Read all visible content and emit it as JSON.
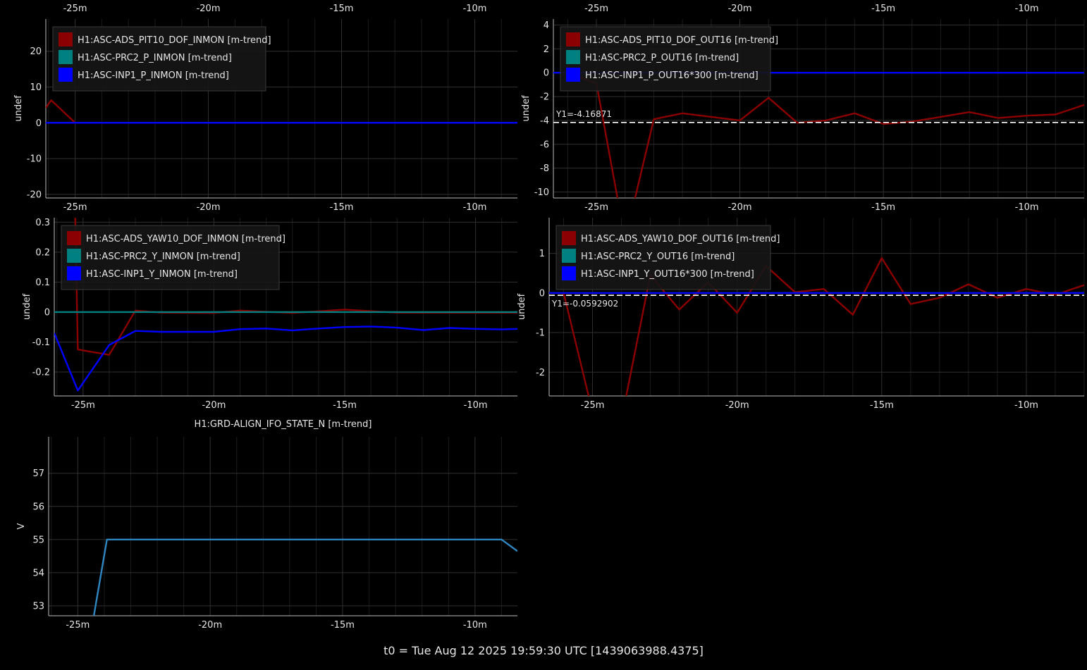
{
  "footer": "t0 = Tue Aug 12 2025 19:59:30 UTC [1439063988.4375]",
  "colors": {
    "background": "#000000",
    "grid": "#2a2a2a",
    "axis": "#bbbbbb",
    "text": "#e6e6e6",
    "legend_bg": "#161616",
    "legend_border": "#3a3a3a",
    "cursor": "#ffffff"
  },
  "chart_data": [
    {
      "id": "pit-inmon",
      "type": "line",
      "ylabel": "undef",
      "xlabel": "",
      "title": "",
      "xlim": [
        -26.1,
        -8.4
      ],
      "ylim": [
        -21,
        29
      ],
      "yticks": [
        -20,
        -10,
        0,
        10,
        20
      ],
      "xticks": [
        -25,
        -20,
        -15,
        -10
      ],
      "xtick_labels": [
        "-25m",
        "-20m",
        "-15m",
        "-10m"
      ],
      "top_tick_labels": true,
      "grid": true,
      "legend": "top-left",
      "series": [
        {
          "name": "H1:ASC-ADS_PIT10_DOF_INMON [m-trend]",
          "color": "#8b0000",
          "x": [
            -26.1,
            -25.9,
            -25.0,
            -24.0,
            -23.0,
            -20.0,
            -15.0,
            -10.0,
            -8.4
          ],
          "y": [
            4.2,
            6.3,
            0,
            0,
            0,
            0,
            0,
            0,
            0
          ]
        },
        {
          "name": "H1:ASC-PRC2_P_INMON [m-trend]",
          "color": "#008080",
          "x": [
            -26.1,
            -8.4
          ],
          "y": [
            0,
            0
          ]
        },
        {
          "name": "H1:ASC-INP1_P_INMON [m-trend]",
          "color": "#0000ff",
          "x": [
            -26.1,
            -8.4
          ],
          "y": [
            0,
            0
          ]
        }
      ]
    },
    {
      "id": "pit-out16",
      "type": "line",
      "ylabel": "undef",
      "xlabel": "",
      "title": "",
      "xlim": [
        -26.5,
        -8.0
      ],
      "ylim": [
        -10.5,
        4.5
      ],
      "yticks": [
        -10,
        -8,
        -6,
        -4,
        -2,
        0,
        2,
        4
      ],
      "xticks": [
        -25,
        -20,
        -15,
        -10
      ],
      "xtick_labels": [
        "-25m",
        "-20m",
        "-15m",
        "-10m"
      ],
      "top_tick_labels": true,
      "grid": true,
      "legend": "top-left",
      "cursor": {
        "y": -4.16871,
        "label": "Y1=-4.16871"
      },
      "series": [
        {
          "name": "H1:ASC-ADS_PIT10_DOF_OUT16 [m-trend]",
          "color": "#8b0000",
          "x": [
            -26.0,
            -25.0,
            -24.0,
            -23.0,
            -22.0,
            -21.0,
            -20.0,
            -19.0,
            -18.0,
            -17.0,
            -16.0,
            -15.0,
            -14.0,
            -13.0,
            -12.0,
            -11.0,
            -10.0,
            -9.0,
            -8.0
          ],
          "y": [
            0.0,
            -0.9,
            -14.0,
            -3.9,
            -3.4,
            -3.7,
            -4.0,
            -2.1,
            -4.2,
            -4.0,
            -3.4,
            -4.3,
            -4.1,
            -3.7,
            -3.3,
            -3.8,
            -3.6,
            -3.5,
            -2.7
          ]
        },
        {
          "name": "H1:ASC-PRC2_P_OUT16 [m-trend]",
          "color": "#008080",
          "x": [
            -26.5,
            -8.0
          ],
          "y": [
            0,
            0
          ]
        },
        {
          "name": "H1:ASC-INP1_P_OUT16*300 [m-trend]",
          "color": "#0000ff",
          "x": [
            -26.5,
            -8.0
          ],
          "y": [
            0,
            0
          ]
        }
      ]
    },
    {
      "id": "yaw-inmon",
      "type": "line",
      "ylabel": "undef",
      "xlabel": "",
      "title": "",
      "xlim": [
        -26.1,
        -8.4
      ],
      "ylim": [
        -0.28,
        0.315
      ],
      "yticks": [
        -0.2,
        -0.1,
        0,
        0.1,
        0.2,
        0.3
      ],
      "xticks": [
        -25,
        -20,
        -15,
        -10
      ],
      "xtick_labels": [
        "-25m",
        "-20m",
        "-15m",
        "-10m"
      ],
      "top_tick_labels": false,
      "grid": true,
      "legend": "top-left",
      "series": [
        {
          "name": "H1:ASC-ADS_YAW10_DOF_INMON [m-trend]",
          "color": "#8b0000",
          "x": [
            -25.3,
            -25.2,
            -24.0,
            -23.0,
            -22.0,
            -20.0,
            -19.0,
            -17.0,
            -15.0,
            -13.0,
            -10.0,
            -8.4
          ],
          "y": [
            0.32,
            -0.125,
            -0.143,
            0.005,
            -0.002,
            -0.003,
            0.005,
            -0.003,
            0.008,
            -0.002,
            -0.002,
            -0.002
          ]
        },
        {
          "name": "H1:ASC-PRC2_Y_INMON [m-trend]",
          "color": "#008080",
          "x": [
            -26.1,
            -8.4
          ],
          "y": [
            0,
            0
          ]
        },
        {
          "name": "H1:ASC-INP1_Y_INMON [m-trend]",
          "color": "#0000ff",
          "x": [
            -26.1,
            -25.2,
            -24.0,
            -23.0,
            -22.0,
            -21.0,
            -20.0,
            -19.0,
            -18.0,
            -17.0,
            -16.0,
            -15.0,
            -14.0,
            -13.0,
            -12.0,
            -11.0,
            -10.0,
            -9.0,
            -8.4
          ],
          "y": [
            -0.07,
            -0.262,
            -0.11,
            -0.063,
            -0.066,
            -0.066,
            -0.066,
            -0.057,
            -0.055,
            -0.061,
            -0.055,
            -0.05,
            -0.048,
            -0.052,
            -0.06,
            -0.053,
            -0.056,
            -0.058,
            -0.056
          ]
        }
      ]
    },
    {
      "id": "yaw-out16",
      "type": "line",
      "ylabel": "undef",
      "xlabel": "",
      "title": "",
      "xlim": [
        -26.5,
        -8.0
      ],
      "ylim": [
        -2.6,
        1.9
      ],
      "yticks": [
        -2,
        -1,
        0,
        1
      ],
      "xticks": [
        -25,
        -20,
        -15,
        -10
      ],
      "xtick_labels": [
        "-25m",
        "-20m",
        "-15m",
        "-10m"
      ],
      "top_tick_labels": false,
      "grid": true,
      "legend": "top-left",
      "cursor": {
        "y": -0.0592902,
        "label": "Y1=-0.0592902"
      },
      "series": [
        {
          "name": "H1:ASC-ADS_YAW10_DOF_OUT16 [m-trend]",
          "color": "#8b0000",
          "x": [
            -26.0,
            -25.0,
            -24.0,
            -23.0,
            -22.0,
            -21.0,
            -20.0,
            -19.0,
            -18.0,
            -17.0,
            -16.0,
            -15.0,
            -14.0,
            -13.0,
            -12.0,
            -11.0,
            -10.0,
            -9.0,
            -8.0
          ],
          "y": [
            0.0,
            -3.0,
            -3.2,
            0.45,
            -0.42,
            0.27,
            -0.5,
            0.68,
            0.02,
            0.1,
            -0.55,
            0.88,
            -0.28,
            -0.12,
            0.22,
            -0.12,
            0.1,
            -0.05,
            0.2
          ]
        },
        {
          "name": "H1:ASC-PRC2_Y_OUT16 [m-trend]",
          "color": "#008080",
          "x": [
            -26.5,
            -8.0
          ],
          "y": [
            0,
            0
          ]
        },
        {
          "name": "H1:ASC-INP1_Y_OUT16*300 [m-trend]",
          "color": "#0000ff",
          "x": [
            -26.5,
            -8.0
          ],
          "y": [
            0,
            0
          ]
        }
      ]
    },
    {
      "id": "guardian",
      "type": "line",
      "title": "H1:GRD-ALIGN_IFO_STATE_N [m-trend]",
      "ylabel": "V",
      "xlabel": "",
      "xlim": [
        -26.1,
        -8.4
      ],
      "ylim": [
        52.7,
        58.1
      ],
      "yticks": [
        53,
        54,
        55,
        56,
        57
      ],
      "xticks": [
        -25,
        -20,
        -15,
        -10
      ],
      "xtick_labels": [
        "-25m",
        "-20m",
        "-15m",
        "-10m"
      ],
      "top_tick_labels": false,
      "grid": true,
      "legend": "none",
      "series": [
        {
          "color": "#2e86c1",
          "x": [
            -24.5,
            -23.9,
            -9.0,
            -8.4
          ],
          "y": [
            52.2,
            55.0,
            55.0,
            54.65
          ]
        }
      ]
    }
  ]
}
